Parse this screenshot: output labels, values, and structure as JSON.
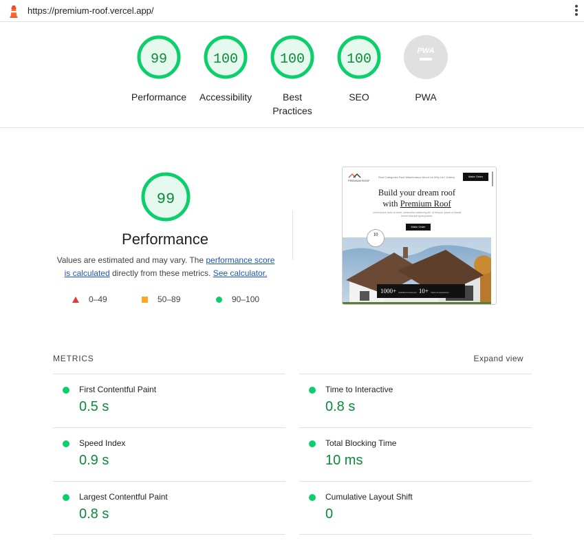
{
  "topbar": {
    "url": "https://premium-roof.vercel.app/",
    "logo_icon": "lighthouse-icon",
    "menu_icon": "more-vert-icon"
  },
  "gauges": [
    {
      "score": "99",
      "label": "Performance",
      "state": "pass"
    },
    {
      "score": "100",
      "label": "Accessibility",
      "state": "pass"
    },
    {
      "score": "100",
      "label_line1": "Best",
      "label_line2": "Practices",
      "state": "pass"
    },
    {
      "score": "100",
      "label": "SEO",
      "state": "pass"
    },
    {
      "score": "PWA",
      "label": "PWA",
      "state": "na"
    }
  ],
  "performance": {
    "score": "99",
    "title": "Performance",
    "desc_before": "Values are estimated and may vary. The ",
    "link_score": "performance score is calculated",
    "desc_mid": " directly from these metrics. ",
    "link_calc": "See calculator.",
    "legend": [
      {
        "range": "0–49",
        "shape": "triangle",
        "color": "#e53935"
      },
      {
        "range": "50–89",
        "shape": "square",
        "color": "#ffa726"
      },
      {
        "range": "90–100",
        "shape": "circle",
        "color": "#0cce6b"
      }
    ]
  },
  "thumbnail": {
    "brand": "PREMIUM ROOF",
    "nav_links": "Roof Categories   Roof Maintenance   About Us   Why Us?   Gallery",
    "nav_button": "Make Order",
    "heading_line1": "Build your dream roof",
    "heading_line2_pre": "with ",
    "heading_line2_em": "Premium Roof",
    "subtext": "Lorem ipsum dolor sit amet, consectetur adipiscing elit. Ut tempus, ipsum ut blandit laoreet suscipit ligula gravida.",
    "cta": "Make Order",
    "badge": "10",
    "stat1_value": "1000+",
    "stat1_label": "Satisfied Customers",
    "stat2_value": "10+",
    "stat2_label": "Years of experience"
  },
  "metrics": {
    "heading": "METRICS",
    "expand_label": "Expand view",
    "items": [
      {
        "name": "First Contentful Paint",
        "value": "0.5 s"
      },
      {
        "name": "Time to Interactive",
        "value": "0.8 s"
      },
      {
        "name": "Speed Index",
        "value": "0.9 s"
      },
      {
        "name": "Total Blocking Time",
        "value": "10 ms"
      },
      {
        "name": "Largest Contentful Paint",
        "value": "0.8 s"
      },
      {
        "name": "Cumulative Layout Shift",
        "value": "0"
      }
    ]
  },
  "colors": {
    "pass": "#0cce6b",
    "pass_text": "#0a8a3a",
    "pass_fill": "#e6f9ee",
    "na": "#e0e0e0",
    "link": "#1a56b0"
  }
}
